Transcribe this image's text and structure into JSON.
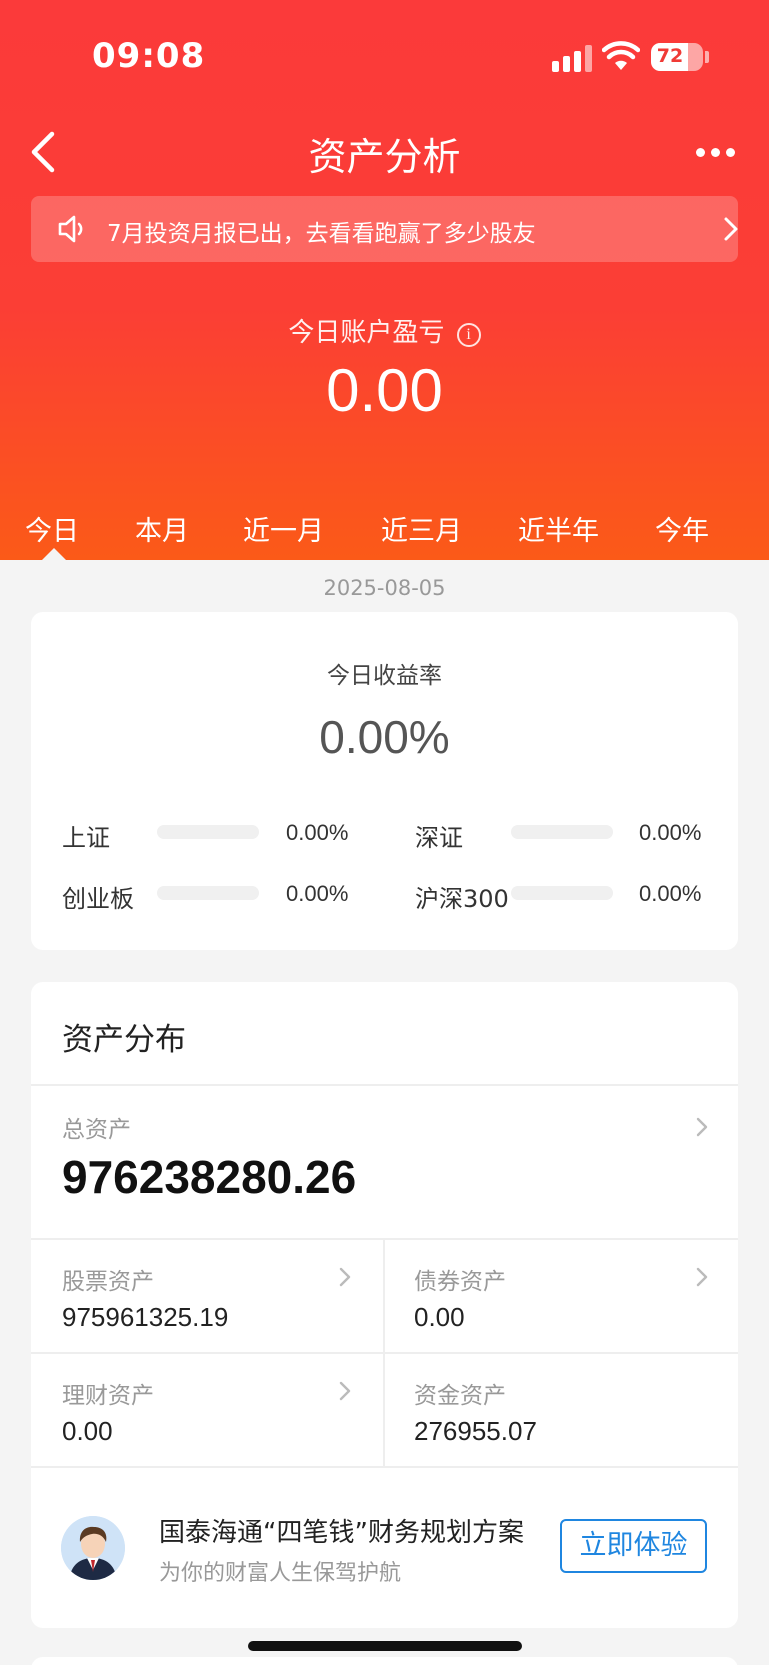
{
  "status_bar": {
    "time": "09:08",
    "battery_level": "72",
    "battery_fraction": 0.72
  },
  "nav": {
    "title": "资产分析"
  },
  "notice": {
    "text": "7月投资月报已出，去看看跑赢了多少股友"
  },
  "profit": {
    "label": "今日账户盈亏",
    "value": "0.00"
  },
  "tabs": [
    {
      "label": "今日",
      "active": true
    },
    {
      "label": "本月"
    },
    {
      "label": "近一月"
    },
    {
      "label": "近三月"
    },
    {
      "label": "近半年"
    },
    {
      "label": "今年"
    }
  ],
  "date": "2025-08-05",
  "rate_card": {
    "label": "今日收益率",
    "value": "0.00%",
    "indices": [
      {
        "name": "上证",
        "value": "0.00%",
        "fraction": 0
      },
      {
        "name": "深证",
        "value": "0.00%",
        "fraction": 0
      },
      {
        "name": "创业板",
        "value": "0.00%",
        "fraction": 0
      },
      {
        "name": "沪深300",
        "value": "0.00%",
        "fraction": 0
      }
    ]
  },
  "assets": {
    "title": "资产分布",
    "total_label": "总资产",
    "total_value": "976238280.26",
    "stock_label": "股票资产",
    "stock_value": "975961325.19",
    "bond_label": "债券资产",
    "bond_value": "0.00",
    "wealth_label": "理财资产",
    "wealth_value": "0.00",
    "cash_label": "资金资产",
    "cash_value": "276955.07"
  },
  "promo": {
    "title": "国泰海通“四笔钱”财务规划方案",
    "subtitle": "为你的财富人生保驾护航",
    "button": "立即体验"
  },
  "colors": {
    "header_top": "#fb3a3a",
    "header_bottom": "#fb5a18",
    "accent_blue": "#1f86e0"
  }
}
